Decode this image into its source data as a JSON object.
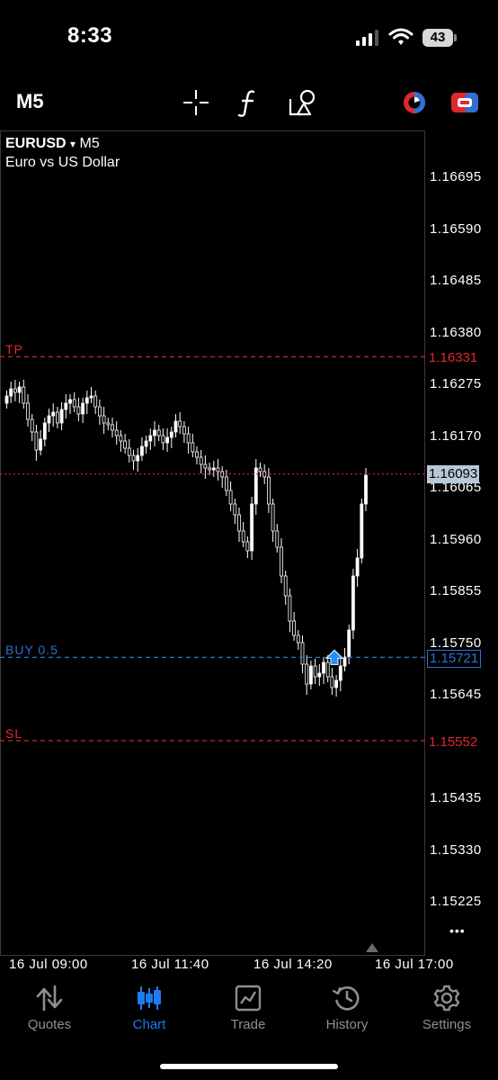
{
  "status_bar": {
    "time": "8:33",
    "battery": "43"
  },
  "toolbar": {
    "timeframe": "M5"
  },
  "chart": {
    "symbol": "EURUSD",
    "dropdown_glyph": "▾",
    "period": "M5",
    "description": "Euro vs US Dollar",
    "tp": {
      "label": "TP",
      "price": "1.16331"
    },
    "sl": {
      "label": "SL",
      "price": "1.15552"
    },
    "buy": {
      "label": "BUY 0.5",
      "price": "1.15721"
    },
    "current_price": "1.16093",
    "price_axis": [
      "1.16695",
      "1.16590",
      "1.16485",
      "1.16380",
      "1.16275",
      "1.16170",
      "1.16065",
      "1.15960",
      "1.15855",
      "1.15750",
      "1.15645",
      "1.15435",
      "1.15330",
      "1.15225"
    ],
    "time_axis": [
      "16 Jul 09:00",
      "16 Jul 11:40",
      "16 Jul 14:20",
      "16 Jul 17:00"
    ],
    "more_glyph": "•••",
    "colors": {
      "tp_sl": "#e0282e",
      "buy": "#2f6fd6",
      "current": "#e0282e",
      "candle": "#ffffff"
    }
  },
  "nav": {
    "items": [
      {
        "label": "Quotes"
      },
      {
        "label": "Chart"
      },
      {
        "label": "Trade"
      },
      {
        "label": "History"
      },
      {
        "label": "Settings"
      }
    ],
    "active_color": "#1e7bf2"
  }
}
